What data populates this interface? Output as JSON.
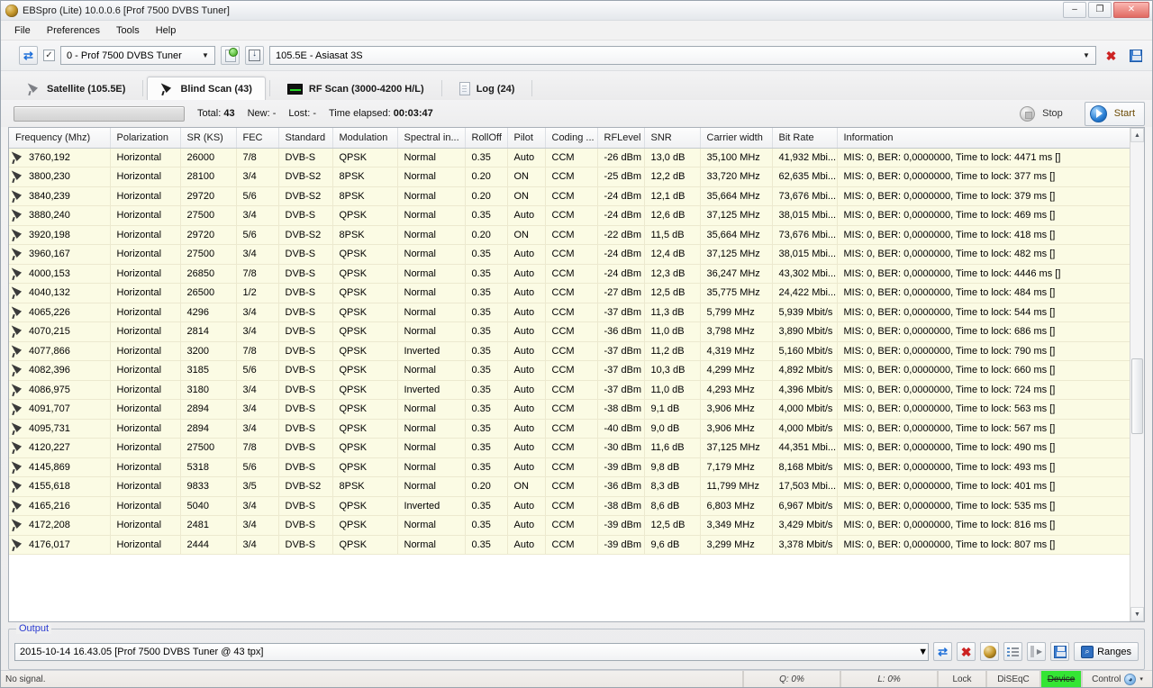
{
  "window": {
    "title": "EBSpro (Lite) 10.0.0.6 [Prof 7500 DVBS Tuner]",
    "app_icon": "globe-icon",
    "minimize": "–",
    "maximize": "❐",
    "close": "✕"
  },
  "menu": {
    "items": [
      {
        "label": "File"
      },
      {
        "label": "Preferences"
      },
      {
        "label": "Tools"
      },
      {
        "label": "Help"
      }
    ]
  },
  "toolbar": {
    "refresh_icon": "refresh-icon",
    "enable_checkbox_checked": "✓",
    "tuner": {
      "value": "0 - Prof 7500 DVBS Tuner",
      "arrow": "▼"
    },
    "new_icon": "new-document-icon",
    "import_icon": "import-icon",
    "satellite": {
      "value": "105.5E - Asiasat 3S",
      "arrow": "▼"
    },
    "delete_icon": "✖",
    "save_icon": "save-icon"
  },
  "tabs": [
    {
      "label": "Satellite (105.5E)",
      "icon": "satellite-dish-icon",
      "active": false
    },
    {
      "label": "Blind Scan (43)",
      "icon": "satellite-dish-icon",
      "active": true
    },
    {
      "label": "RF Scan (3000-4200 H/L)",
      "icon": "spectrum-icon",
      "active": false
    },
    {
      "label": "Log (24)",
      "icon": "document-icon",
      "active": false
    }
  ],
  "scan_status": {
    "total_label": "Total:",
    "total_value": "43",
    "new_label": "New:",
    "new_value": "-",
    "lost_label": "Lost:",
    "lost_value": "-",
    "time_label": "Time elapsed:",
    "time_value": "00:03:47",
    "stop_label": "Stop",
    "start_label": "Start"
  },
  "table": {
    "columns": [
      "Frequency (Mhz)",
      "Polarization",
      "SR (KS)",
      "FEC",
      "Standard",
      "Modulation",
      "Spectral in...",
      "RollOff",
      "Pilot",
      "Coding ...",
      "RFLevel",
      "SNR",
      "Carrier width",
      "Bit Rate",
      "Information"
    ],
    "rows": [
      [
        "3760,192",
        "Horizontal",
        "26000",
        "7/8",
        "DVB-S",
        "QPSK",
        "Normal",
        "0.35",
        "Auto",
        "CCM",
        "-26 dBm",
        "13,0 dB",
        "35,100 MHz",
        "41,932 Mbi...",
        "MIS: 0, BER: 0,0000000, Time to lock: 4471 ms []"
      ],
      [
        "3800,230",
        "Horizontal",
        "28100",
        "3/4",
        "DVB-S2",
        "8PSK",
        "Normal",
        "0.20",
        "ON",
        "CCM",
        "-25 dBm",
        "12,2 dB",
        "33,720 MHz",
        "62,635 Mbi...",
        "MIS: 0, BER: 0,0000000, Time to lock: 377 ms []"
      ],
      [
        "3840,239",
        "Horizontal",
        "29720",
        "5/6",
        "DVB-S2",
        "8PSK",
        "Normal",
        "0.20",
        "ON",
        "CCM",
        "-24 dBm",
        "12,1 dB",
        "35,664 MHz",
        "73,676 Mbi...",
        "MIS: 0, BER: 0,0000000, Time to lock: 379 ms []"
      ],
      [
        "3880,240",
        "Horizontal",
        "27500",
        "3/4",
        "DVB-S",
        "QPSK",
        "Normal",
        "0.35",
        "Auto",
        "CCM",
        "-24 dBm",
        "12,6 dB",
        "37,125 MHz",
        "38,015 Mbi...",
        "MIS: 0, BER: 0,0000000, Time to lock: 469 ms []"
      ],
      [
        "3920,198",
        "Horizontal",
        "29720",
        "5/6",
        "DVB-S2",
        "8PSK",
        "Normal",
        "0.20",
        "ON",
        "CCM",
        "-22 dBm",
        "11,5 dB",
        "35,664 MHz",
        "73,676 Mbi...",
        "MIS: 0, BER: 0,0000000, Time to lock: 418 ms []"
      ],
      [
        "3960,167",
        "Horizontal",
        "27500",
        "3/4",
        "DVB-S",
        "QPSK",
        "Normal",
        "0.35",
        "Auto",
        "CCM",
        "-24 dBm",
        "12,4 dB",
        "37,125 MHz",
        "38,015 Mbi...",
        "MIS: 0, BER: 0,0000000, Time to lock: 482 ms []"
      ],
      [
        "4000,153",
        "Horizontal",
        "26850",
        "7/8",
        "DVB-S",
        "QPSK",
        "Normal",
        "0.35",
        "Auto",
        "CCM",
        "-24 dBm",
        "12,3 dB",
        "36,247 MHz",
        "43,302 Mbi...",
        "MIS: 0, BER: 0,0000000, Time to lock: 4446 ms []"
      ],
      [
        "4040,132",
        "Horizontal",
        "26500",
        "1/2",
        "DVB-S",
        "QPSK",
        "Normal",
        "0.35",
        "Auto",
        "CCM",
        "-27 dBm",
        "12,5 dB",
        "35,775 MHz",
        "24,422 Mbi...",
        "MIS: 0, BER: 0,0000000, Time to lock: 484 ms []"
      ],
      [
        "4065,226",
        "Horizontal",
        "4296",
        "3/4",
        "DVB-S",
        "QPSK",
        "Normal",
        "0.35",
        "Auto",
        "CCM",
        "-37 dBm",
        "11,3 dB",
        "5,799 MHz",
        "5,939 Mbit/s",
        "MIS: 0, BER: 0,0000000, Time to lock: 544 ms []"
      ],
      [
        "4070,215",
        "Horizontal",
        "2814",
        "3/4",
        "DVB-S",
        "QPSK",
        "Normal",
        "0.35",
        "Auto",
        "CCM",
        "-36 dBm",
        "11,0 dB",
        "3,798 MHz",
        "3,890 Mbit/s",
        "MIS: 0, BER: 0,0000000, Time to lock: 686 ms []"
      ],
      [
        "4077,866",
        "Horizontal",
        "3200",
        "7/8",
        "DVB-S",
        "QPSK",
        "Inverted",
        "0.35",
        "Auto",
        "CCM",
        "-37 dBm",
        "11,2 dB",
        "4,319 MHz",
        "5,160 Mbit/s",
        "MIS: 0, BER: 0,0000000, Time to lock: 790 ms []"
      ],
      [
        "4082,396",
        "Horizontal",
        "3185",
        "5/6",
        "DVB-S",
        "QPSK",
        "Normal",
        "0.35",
        "Auto",
        "CCM",
        "-37 dBm",
        "10,3 dB",
        "4,299 MHz",
        "4,892 Mbit/s",
        "MIS: 0, BER: 0,0000000, Time to lock: 660 ms []"
      ],
      [
        "4086,975",
        "Horizontal",
        "3180",
        "3/4",
        "DVB-S",
        "QPSK",
        "Inverted",
        "0.35",
        "Auto",
        "CCM",
        "-37 dBm",
        "11,0 dB",
        "4,293 MHz",
        "4,396 Mbit/s",
        "MIS: 0, BER: 0,0000000, Time to lock: 724 ms []"
      ],
      [
        "4091,707",
        "Horizontal",
        "2894",
        "3/4",
        "DVB-S",
        "QPSK",
        "Normal",
        "0.35",
        "Auto",
        "CCM",
        "-38 dBm",
        "9,1 dB",
        "3,906 MHz",
        "4,000 Mbit/s",
        "MIS: 0, BER: 0,0000000, Time to lock: 563 ms []"
      ],
      [
        "4095,731",
        "Horizontal",
        "2894",
        "3/4",
        "DVB-S",
        "QPSK",
        "Normal",
        "0.35",
        "Auto",
        "CCM",
        "-40 dBm",
        "9,0 dB",
        "3,906 MHz",
        "4,000 Mbit/s",
        "MIS: 0, BER: 0,0000000, Time to lock: 567 ms []"
      ],
      [
        "4120,227",
        "Horizontal",
        "27500",
        "7/8",
        "DVB-S",
        "QPSK",
        "Normal",
        "0.35",
        "Auto",
        "CCM",
        "-30 dBm",
        "11,6 dB",
        "37,125 MHz",
        "44,351 Mbi...",
        "MIS: 0, BER: 0,0000000, Time to lock: 490 ms []"
      ],
      [
        "4145,869",
        "Horizontal",
        "5318",
        "5/6",
        "DVB-S",
        "QPSK",
        "Normal",
        "0.35",
        "Auto",
        "CCM",
        "-39 dBm",
        "9,8 dB",
        "7,179 MHz",
        "8,168 Mbit/s",
        "MIS: 0, BER: 0,0000000, Time to lock: 493 ms []"
      ],
      [
        "4155,618",
        "Horizontal",
        "9833",
        "3/5",
        "DVB-S2",
        "8PSK",
        "Normal",
        "0.20",
        "ON",
        "CCM",
        "-36 dBm",
        "8,3 dB",
        "11,799 MHz",
        "17,503 Mbi...",
        "MIS: 0, BER: 0,0000000, Time to lock: 401 ms []"
      ],
      [
        "4165,216",
        "Horizontal",
        "5040",
        "3/4",
        "DVB-S",
        "QPSK",
        "Inverted",
        "0.35",
        "Auto",
        "CCM",
        "-38 dBm",
        "8,6 dB",
        "6,803 MHz",
        "6,967 Mbit/s",
        "MIS: 0, BER: 0,0000000, Time to lock: 535 ms []"
      ],
      [
        "4172,208",
        "Horizontal",
        "2481",
        "3/4",
        "DVB-S",
        "QPSK",
        "Normal",
        "0.35",
        "Auto",
        "CCM",
        "-39 dBm",
        "12,5 dB",
        "3,349 MHz",
        "3,429 Mbit/s",
        "MIS: 0, BER: 0,0000000, Time to lock: 816 ms []"
      ],
      [
        "4176,017",
        "Horizontal",
        "2444",
        "3/4",
        "DVB-S",
        "QPSK",
        "Normal",
        "0.35",
        "Auto",
        "CCM",
        "-39 dBm",
        "9,6 dB",
        "3,299 MHz",
        "3,378 Mbit/s",
        "MIS: 0, BER: 0,0000000, Time to lock: 807 ms []"
      ]
    ]
  },
  "output": {
    "legend": "Output",
    "value": "2015-10-14 16.43.05 [Prof 7500 DVBS Tuner @ 43 tpx]",
    "arrow": "▼",
    "buttons": [
      {
        "name": "refresh",
        "icon": "refresh-icon"
      },
      {
        "name": "delete",
        "icon": "delete-icon"
      },
      {
        "name": "globe",
        "icon": "globe-icon"
      },
      {
        "name": "list",
        "icon": "list-icon"
      },
      {
        "name": "export",
        "icon": "export-icon"
      },
      {
        "name": "save",
        "icon": "save-icon"
      }
    ],
    "ranges_label": "Ranges",
    "ranges_icon": "magnifier-icon"
  },
  "statusbar": {
    "message": "No signal.",
    "quality": "Q: 0%",
    "level": "L: 0%",
    "lock": "Lock",
    "diseqc": "DiSEqC",
    "device": "Device",
    "control": "Control",
    "control_icon": "signal-icon",
    "control_arrow": "▾",
    "device_color": "#34e534"
  }
}
